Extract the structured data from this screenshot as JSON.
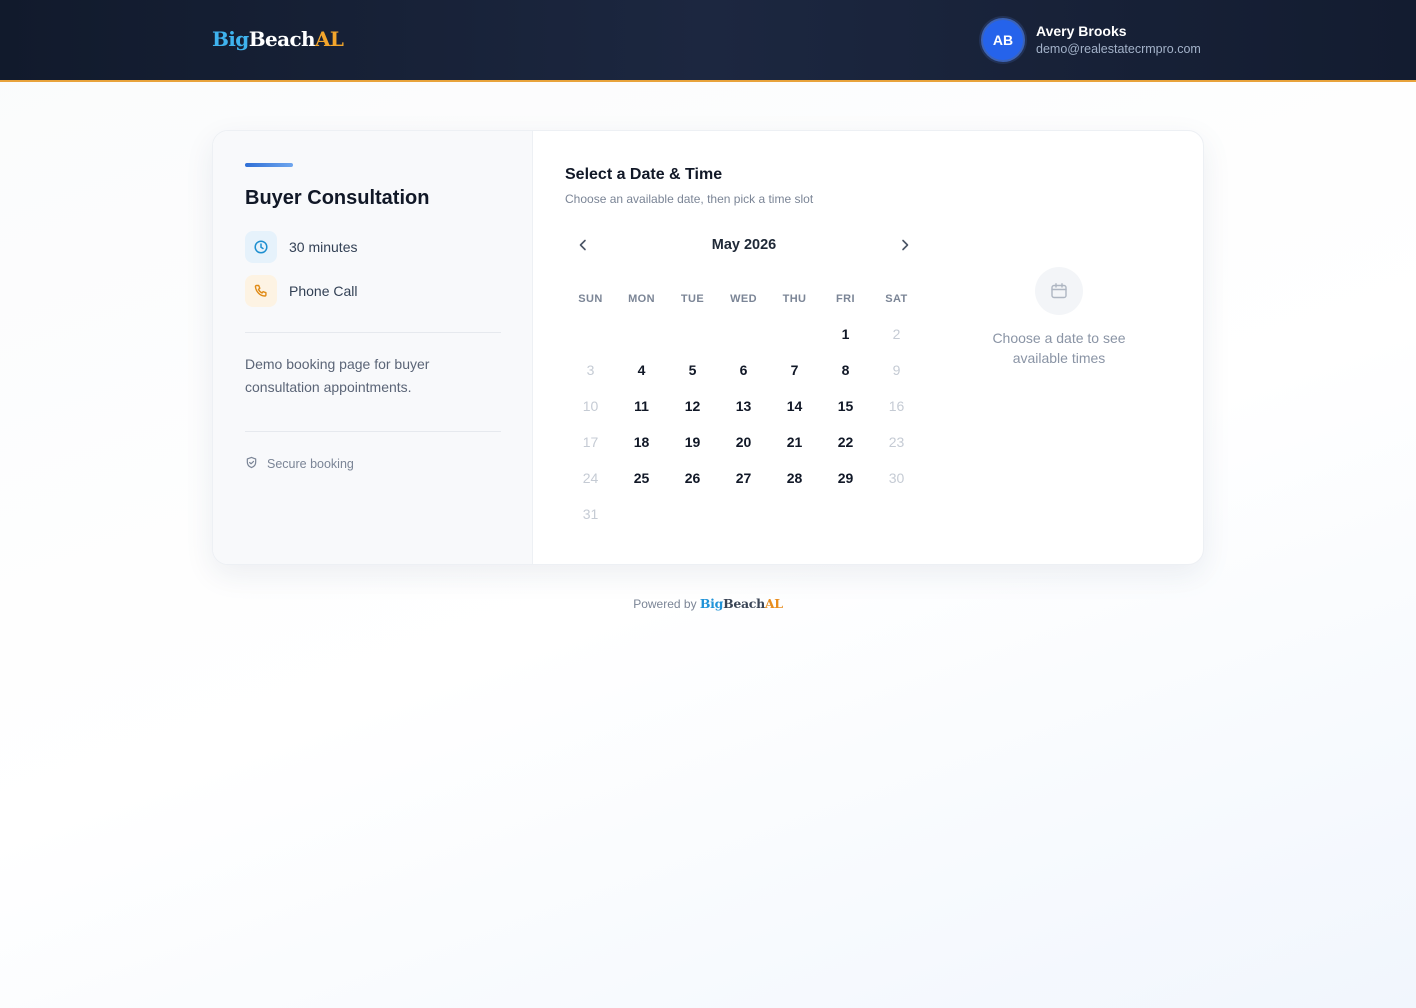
{
  "header": {
    "logo": {
      "part1": "Big",
      "part2": "Beach",
      "part3": "AL"
    },
    "user": {
      "initials": "AB",
      "name": "Avery Brooks",
      "email": "demo@realestatecrmpro.com"
    }
  },
  "event": {
    "title": "Buyer Consultation",
    "duration": "30 minutes",
    "location": "Phone Call",
    "description": "Demo booking page for buyer consultation appointments.",
    "secure_label": "Secure booking",
    "icons": [
      "clock-icon",
      "phone-icon",
      "shield-icon"
    ]
  },
  "scheduler": {
    "title": "Select a Date & Time",
    "subtitle": "Choose an available date, then pick a time slot",
    "month_label": "May 2026",
    "weekdays": [
      "SUN",
      "MON",
      "TUE",
      "WED",
      "THU",
      "FRI",
      "SAT"
    ],
    "start_weekday_index": 5,
    "days": [
      {
        "d": "1",
        "available": true
      },
      {
        "d": "2",
        "available": false
      },
      {
        "d": "3",
        "available": false
      },
      {
        "d": "4",
        "available": true
      },
      {
        "d": "5",
        "available": true
      },
      {
        "d": "6",
        "available": true
      },
      {
        "d": "7",
        "available": true
      },
      {
        "d": "8",
        "available": true
      },
      {
        "d": "9",
        "available": false
      },
      {
        "d": "10",
        "available": false
      },
      {
        "d": "11",
        "available": true
      },
      {
        "d": "12",
        "available": true
      },
      {
        "d": "13",
        "available": true
      },
      {
        "d": "14",
        "available": true
      },
      {
        "d": "15",
        "available": true
      },
      {
        "d": "16",
        "available": false
      },
      {
        "d": "17",
        "available": false
      },
      {
        "d": "18",
        "available": true
      },
      {
        "d": "19",
        "available": true
      },
      {
        "d": "20",
        "available": true
      },
      {
        "d": "21",
        "available": true
      },
      {
        "d": "22",
        "available": true
      },
      {
        "d": "23",
        "available": false
      },
      {
        "d": "24",
        "available": false
      },
      {
        "d": "25",
        "available": true
      },
      {
        "d": "26",
        "available": true
      },
      {
        "d": "27",
        "available": true
      },
      {
        "d": "28",
        "available": true
      },
      {
        "d": "29",
        "available": true
      },
      {
        "d": "30",
        "available": false
      },
      {
        "d": "31",
        "available": false
      }
    ],
    "times_empty_message": "Choose a date to see available times"
  },
  "footer": {
    "powered_by": "Powered by",
    "logo": {
      "part1": "Big",
      "part2": "Beach",
      "part3": "AL"
    }
  },
  "colors": {
    "accent_blue": "#2563eb",
    "brand_orange": "#f2a52c",
    "brand_cyan": "#3fb3ee",
    "header_bg": "#111a2c"
  }
}
